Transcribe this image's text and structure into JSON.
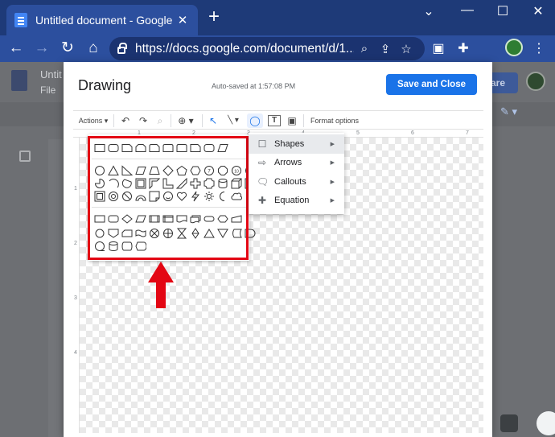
{
  "browser": {
    "tab_title": "Untitled document - Google Doc",
    "tab_close": "✕",
    "new_tab": "+",
    "window_controls": [
      "⌄",
      "—",
      "☐",
      "✕"
    ],
    "url": "https://docs.google.com/document/d/1...",
    "omnibox_icons": [
      "search-icon",
      "share-icon",
      "star-icon"
    ]
  },
  "docs": {
    "title_fragment": "Untit",
    "menu_fragment": "File",
    "share_fragment": "are"
  },
  "dialog": {
    "title": "Drawing",
    "autosave": "Auto-saved at 1:57:08 PM",
    "save_close": "Save and Close"
  },
  "toolbar": {
    "actions": "Actions ▾",
    "undo": "↶",
    "redo": "↷",
    "paint": "⌕",
    "zoom": "⊕ ▾",
    "select": "↖",
    "line": "╲ ▾",
    "shape": "◯",
    "textbox": "T",
    "image": "▣",
    "format_options": "Format options"
  },
  "ruler": {
    "top": [
      "1",
      "2",
      "3",
      "4",
      "5",
      "6",
      "7"
    ],
    "left": [
      "1",
      "2",
      "3",
      "4"
    ]
  },
  "submenu": [
    {
      "label": "Shapes",
      "icon": "square-icon",
      "selected": true
    },
    {
      "label": "Arrows",
      "icon": "arrow-icon",
      "selected": false
    },
    {
      "label": "Callouts",
      "icon": "callout-icon",
      "selected": false
    },
    {
      "label": "Equation",
      "icon": "plus-icon",
      "selected": false
    }
  ],
  "submenu_arrow": "▶",
  "colors": {
    "accent": "#1a73e8",
    "highlight": "#e30613"
  }
}
